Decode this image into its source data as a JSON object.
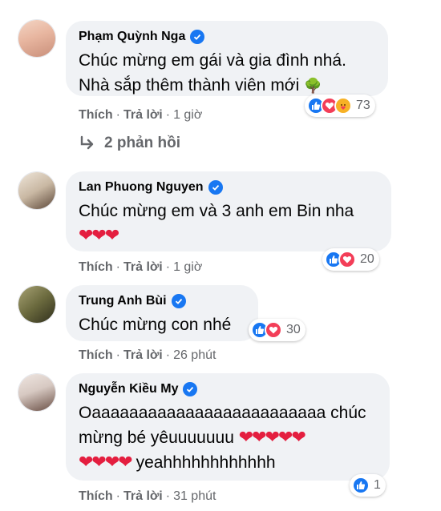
{
  "comments": [
    {
      "author": "Phạm Quỳnh Nga",
      "lines": [
        "Chúc mừng em gái và gia đình nhá.",
        "Nhà sắp thêm thành viên mới"
      ],
      "trailing_emoji": "🌳",
      "like_label": "Thích",
      "reply_label": "Trả lời",
      "time": "1 giờ",
      "reaction_count": "73",
      "avatar_color": "#e8b6a0"
    },
    {
      "author": "Lan Phuong Nguyen",
      "lines": [
        "Chúc mừng em và 3 anh em Bin nha"
      ],
      "hearts": "❤❤❤",
      "like_label": "Thích",
      "reply_label": "Trả lời",
      "time": "1 giờ",
      "reaction_count": "20",
      "avatar_color": "#c9b8a3"
    },
    {
      "author": "Trung Anh Bùi",
      "lines": [
        "Chúc mừng con nhé"
      ],
      "like_label": "Thích",
      "reply_label": "Trả lời",
      "time": "26 phút",
      "reaction_count": "30",
      "avatar_color": "#6b6a3e"
    },
    {
      "author": "Nguyễn Kiều My",
      "lines": [
        "Oaaaaaaaaaaaaaaaaaaaaaaaaa chúc",
        "mừng bé yêuuuuuuu"
      ],
      "hearts_line2": "❤❤❤❤❤",
      "hearts_line3": "❤❤❤❤",
      "line3_text": "yeahhhhhhhhhhhh",
      "like_label": "Thích",
      "reply_label": "Trả lời",
      "time": "31 phút",
      "reaction_count": "1",
      "avatar_color": "#d7c9c2"
    }
  ],
  "replies": {
    "label": "2 phản hồi"
  },
  "separator": "·"
}
